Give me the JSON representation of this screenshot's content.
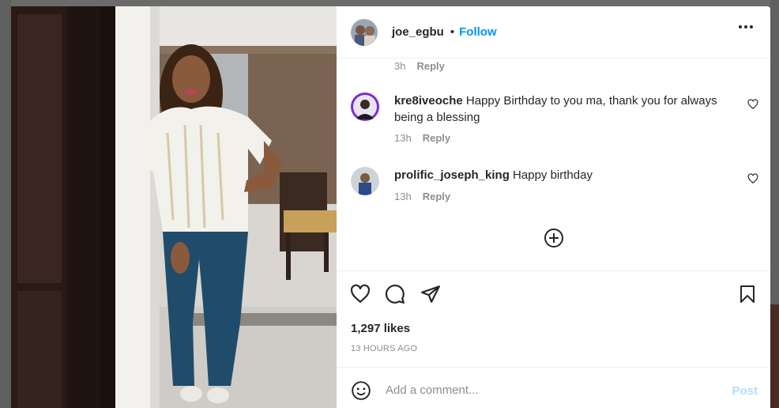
{
  "post": {
    "author": "joe_egbu",
    "separator": "•",
    "follow_label": "Follow",
    "likes": "1,297 likes",
    "timestamp": "13 HOURS AGO"
  },
  "comments": {
    "previous_meta": {
      "time": "3h",
      "reply": "Reply"
    },
    "items": [
      {
        "username": "kre8iveoche",
        "text": "Happy Birthday to you ma, thank you for always being a blessing",
        "time": "13h",
        "reply": "Reply"
      },
      {
        "username": "prolific_joseph_king",
        "text": "Happy birthday",
        "time": "13h",
        "reply": "Reply"
      }
    ]
  },
  "composer": {
    "placeholder": "Add a comment...",
    "post_label": "Post"
  },
  "colors": {
    "accent": "#0095f6",
    "post_disabled": "#b2dffc",
    "text": "#262626",
    "muted": "#8e8e8e"
  },
  "icons": [
    "more-icon",
    "heart-icon",
    "comment-icon",
    "share-icon",
    "bookmark-icon",
    "add-circle-icon",
    "emoji-icon"
  ]
}
